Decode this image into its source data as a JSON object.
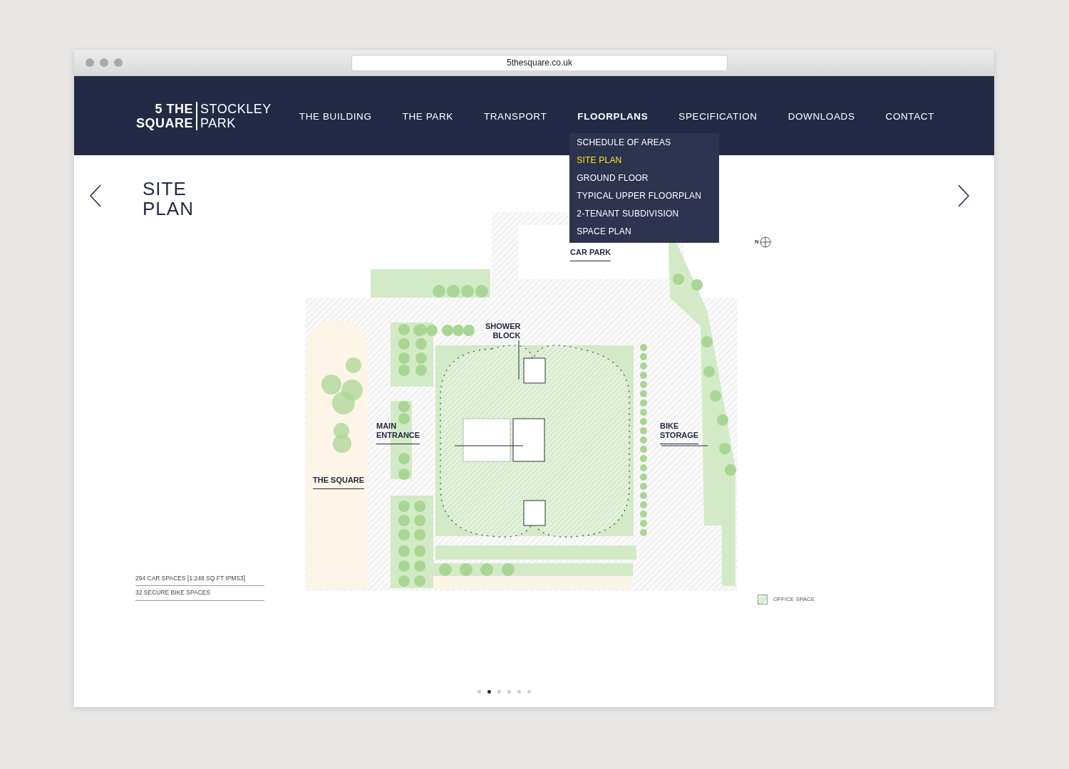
{
  "browser": {
    "url": "5thesquare.co.uk"
  },
  "logo": {
    "bold_lines": [
      "5 THE",
      "SQUARE"
    ],
    "light_lines": [
      "STOCKLEY",
      "PARK"
    ]
  },
  "nav": [
    {
      "label": "THE BUILDING",
      "selected": false
    },
    {
      "label": "THE PARK",
      "selected": false
    },
    {
      "label": "TRANSPORT",
      "selected": false
    },
    {
      "label": "FLOORPLANS",
      "selected": true,
      "dropdown": [
        {
          "label": "SCHEDULE OF AREAS",
          "selected": false
        },
        {
          "label": "SITE PLAN",
          "selected": true
        },
        {
          "label": "GROUND FLOOR",
          "selected": false
        },
        {
          "label": "TYPICAL UPPER FLOORPLAN",
          "selected": false
        },
        {
          "label": "2-TENANT SUBDIVISION",
          "selected": false
        },
        {
          "label": "SPACE PLAN",
          "selected": false
        }
      ]
    },
    {
      "label": "SPECIFICATION",
      "selected": false
    },
    {
      "label": "DOWNLOADS",
      "selected": false
    },
    {
      "label": "CONTACT",
      "selected": false
    }
  ],
  "page_title_lines": [
    "SITE",
    "PLAN"
  ],
  "stats": [
    "294 CAR SPACES [1:248 SQ FT IPMS3]",
    "32 SECURE BIKE SPACES"
  ],
  "plan_labels": [
    {
      "kind": "car-park",
      "lines": [
        "CAR PARK"
      ]
    },
    {
      "kind": "shower",
      "lines": [
        "SHOWER",
        "BLOCK"
      ]
    },
    {
      "kind": "entrance",
      "lines": [
        "MAIN",
        "ENTRANCE"
      ]
    },
    {
      "kind": "bike",
      "lines": [
        "BIKE",
        "STORAGE"
      ]
    },
    {
      "kind": "square",
      "lines": [
        "THE SQUARE"
      ]
    }
  ],
  "compass": {
    "letter": "N"
  },
  "legend": {
    "label": "OFFICE SPACE"
  },
  "pagination": [
    {
      "selected": false
    },
    {
      "selected": true
    },
    {
      "selected": false
    },
    {
      "selected": false
    },
    {
      "selected": false
    },
    {
      "selected": false
    }
  ]
}
